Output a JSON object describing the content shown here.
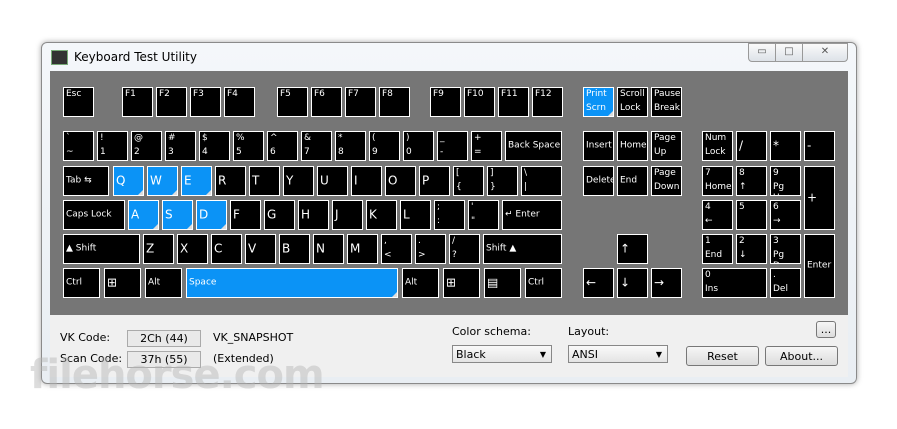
{
  "window": {
    "title": "Keyboard Test Utility",
    "minimize": "▭",
    "maximize": "□",
    "close": "✕"
  },
  "accent": "#0b93f6",
  "keys": [
    {
      "id": "esc",
      "t": "Esc"
    },
    {
      "id": "f1",
      "t": "F1"
    },
    {
      "id": "f2",
      "t": "F2"
    },
    {
      "id": "f3",
      "t": "F3"
    },
    {
      "id": "f4",
      "t": "F4"
    },
    {
      "id": "f5",
      "t": "F5"
    },
    {
      "id": "f6",
      "t": "F6"
    },
    {
      "id": "f7",
      "t": "F7"
    },
    {
      "id": "f8",
      "t": "F8"
    },
    {
      "id": "f9",
      "t": "F9"
    },
    {
      "id": "f10",
      "t": "F10"
    },
    {
      "id": "f11",
      "t": "F11"
    },
    {
      "id": "f12",
      "t": "F12"
    },
    {
      "id": "prtsc",
      "t": "Print",
      "b": "Scrn",
      "pressed": true
    },
    {
      "id": "scrlk",
      "t": "Scroll",
      "b": "Lock"
    },
    {
      "id": "pause",
      "t": "Pause",
      "b": "Break"
    },
    {
      "id": "tilde",
      "t": "`",
      "b": "~"
    },
    {
      "id": "k1",
      "t": "!",
      "b": "1"
    },
    {
      "id": "k2",
      "t": "@",
      "b": "2"
    },
    {
      "id": "k3",
      "t": "#",
      "b": "3"
    },
    {
      "id": "k4",
      "t": "$",
      "b": "4"
    },
    {
      "id": "k5",
      "t": "%",
      "b": "5"
    },
    {
      "id": "k6",
      "t": "^",
      "b": "6"
    },
    {
      "id": "k7",
      "t": "&",
      "b": "7"
    },
    {
      "id": "k8",
      "t": "*",
      "b": "8"
    },
    {
      "id": "k9",
      "t": "(",
      "b": "9"
    },
    {
      "id": "k0",
      "t": ")",
      "b": "0"
    },
    {
      "id": "minus",
      "t": "_",
      "b": "-"
    },
    {
      "id": "equal",
      "t": "+",
      "b": "="
    },
    {
      "id": "bksp",
      "c": "Back Space"
    },
    {
      "id": "ins",
      "c": "Insert"
    },
    {
      "id": "home",
      "c": "Home"
    },
    {
      "id": "pgup",
      "t": "Page",
      "b": "Up"
    },
    {
      "id": "numlk",
      "t": "Num",
      "b": "Lock"
    },
    {
      "id": "ndiv",
      "c": "/"
    },
    {
      "id": "nmul",
      "c": "*"
    },
    {
      "id": "nsub",
      "c": "-"
    },
    {
      "id": "tab",
      "c": "Tab  ⇆"
    },
    {
      "id": "q",
      "c": "Q",
      "pressed": true
    },
    {
      "id": "w",
      "c": "W",
      "pressed": true
    },
    {
      "id": "e",
      "c": "E",
      "pressed": true
    },
    {
      "id": "r",
      "c": "R"
    },
    {
      "id": "t",
      "c": "T"
    },
    {
      "id": "y",
      "c": "Y"
    },
    {
      "id": "u",
      "c": "U"
    },
    {
      "id": "i",
      "c": "I"
    },
    {
      "id": "o",
      "c": "O"
    },
    {
      "id": "p",
      "c": "P"
    },
    {
      "id": "lbr",
      "t": "[",
      "b": "{"
    },
    {
      "id": "rbr",
      "t": "]",
      "b": "}"
    },
    {
      "id": "bslash",
      "t": "\\",
      "b": "|"
    },
    {
      "id": "del",
      "c": "Delete"
    },
    {
      "id": "end",
      "c": "End"
    },
    {
      "id": "pgdn",
      "t": "Page",
      "b": "Down"
    },
    {
      "id": "n7",
      "t": "7",
      "b": "Home"
    },
    {
      "id": "n8",
      "t": "8",
      "b": "↑"
    },
    {
      "id": "n9",
      "t": "9",
      "b": "Pg Up"
    },
    {
      "id": "nadd",
      "c": "+"
    },
    {
      "id": "caps",
      "c": "Caps Lock"
    },
    {
      "id": "a",
      "c": "A",
      "pressed": true
    },
    {
      "id": "s",
      "c": "S",
      "pressed": true
    },
    {
      "id": "d",
      "c": "D",
      "pressed": true
    },
    {
      "id": "f",
      "c": "F"
    },
    {
      "id": "g",
      "c": "G"
    },
    {
      "id": "h",
      "c": "H"
    },
    {
      "id": "j",
      "c": "J"
    },
    {
      "id": "k",
      "c": "K"
    },
    {
      "id": "l",
      "c": "L"
    },
    {
      "id": "semi",
      "t": ";",
      "b": ":"
    },
    {
      "id": "quote",
      "t": "'",
      "b": "\""
    },
    {
      "id": "enter",
      "c": "↵  Enter"
    },
    {
      "id": "n4",
      "t": "4",
      "b": "←"
    },
    {
      "id": "n5",
      "t": "5"
    },
    {
      "id": "n6",
      "t": "6",
      "b": "→"
    },
    {
      "id": "lshift",
      "c": "▲      Shift"
    },
    {
      "id": "z",
      "c": "Z"
    },
    {
      "id": "x",
      "c": "X"
    },
    {
      "id": "cc",
      "c": "C"
    },
    {
      "id": "v",
      "c": "V"
    },
    {
      "id": "b",
      "c": "B"
    },
    {
      "id": "n",
      "c": "N"
    },
    {
      "id": "m",
      "c": "M"
    },
    {
      "id": "comma",
      "t": ",",
      "b": "<"
    },
    {
      "id": "period",
      "t": ".",
      "b": ">"
    },
    {
      "id": "slash",
      "t": "/",
      "b": "?"
    },
    {
      "id": "rshift",
      "c": "Shift         ▲"
    },
    {
      "id": "up",
      "c": "↑"
    },
    {
      "id": "n1",
      "t": "1",
      "b": "End"
    },
    {
      "id": "n2",
      "t": "2",
      "b": "↓"
    },
    {
      "id": "n3",
      "t": "3",
      "b": "Pg Dn"
    },
    {
      "id": "nenter",
      "c": "Enter"
    },
    {
      "id": "lctrl",
      "c": "Ctrl"
    },
    {
      "id": "lwin",
      "c": "⊞"
    },
    {
      "id": "lalt",
      "c": "Alt"
    },
    {
      "id": "space",
      "c": "Space",
      "pressed": true
    },
    {
      "id": "ralt",
      "c": "Alt"
    },
    {
      "id": "rwin",
      "c": "⊞"
    },
    {
      "id": "menu",
      "c": "▤"
    },
    {
      "id": "rctrl",
      "c": "Ctrl"
    },
    {
      "id": "left",
      "c": "←"
    },
    {
      "id": "down",
      "c": "↓"
    },
    {
      "id": "right",
      "c": "→"
    },
    {
      "id": "n0",
      "t": "0",
      "b": "Ins"
    },
    {
      "id": "ndot",
      "t": ".",
      "b": "Del"
    }
  ],
  "footer": {
    "vk_label": "VK Code:",
    "vk_value": "2Ch (44)",
    "vk_name": "VK_SNAPSHOT",
    "scan_label": "Scan Code:",
    "scan_value": "37h (55)",
    "scan_note": "(Extended)",
    "color_label": "Color schema:",
    "color_value": "Black",
    "layout_label": "Layout:",
    "layout_value": "ANSI",
    "more": "...",
    "reset": "Reset",
    "about": "About..."
  },
  "watermark": "filehorse.com"
}
